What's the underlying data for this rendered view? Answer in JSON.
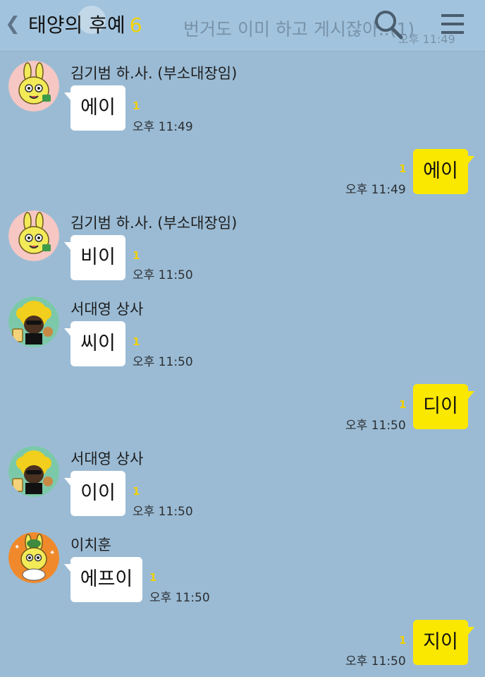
{
  "header": {
    "title": "태양의 후예",
    "member_count": "6",
    "back_icon": "chevron-left-icon",
    "search_icon": "search-icon",
    "menu_icon": "hamburger-menu-icon",
    "notice_text": "번거도 이미 하고 게시잖아..(1)",
    "notice_time": "오후 11:49"
  },
  "colors": {
    "background": "#9bbbd4",
    "my_bubble": "#fbe800",
    "other_bubble": "#ffffff",
    "unread": "#f2d000"
  },
  "messages": [
    {
      "sender": "김기범 하.사. (부소대장임)",
      "text": "에이",
      "unread": "1",
      "time": "오후 11:49",
      "mine": false,
      "avatar": "yellow-rabbit-avatar-icon"
    },
    {
      "text": "에이",
      "unread": "1",
      "time": "오후 11:49",
      "mine": true
    },
    {
      "sender": "김기범 하.사. (부소대장임)",
      "text": "비이",
      "unread": "1",
      "time": "오후 11:50",
      "mine": false,
      "avatar": "yellow-rabbit-avatar-icon"
    },
    {
      "sender": "서대영 상사",
      "text": "씨이",
      "unread": "1",
      "time": "오후 11:50",
      "mine": false,
      "avatar": "afro-character-avatar-icon"
    },
    {
      "text": "디이",
      "unread": "1",
      "time": "오후 11:50",
      "mine": true
    },
    {
      "sender": "서대영 상사",
      "text": "이이",
      "unread": "1",
      "time": "오후 11:50",
      "mine": false,
      "avatar": "afro-character-avatar-icon"
    },
    {
      "sender": "이치훈",
      "text": "에프이",
      "unread": "1",
      "time": "오후 11:50",
      "mine": false,
      "avatar": "rabbit-with-hat-avatar-icon"
    },
    {
      "text": "지이",
      "unread": "1",
      "time": "오후 11:50",
      "mine": true
    }
  ]
}
